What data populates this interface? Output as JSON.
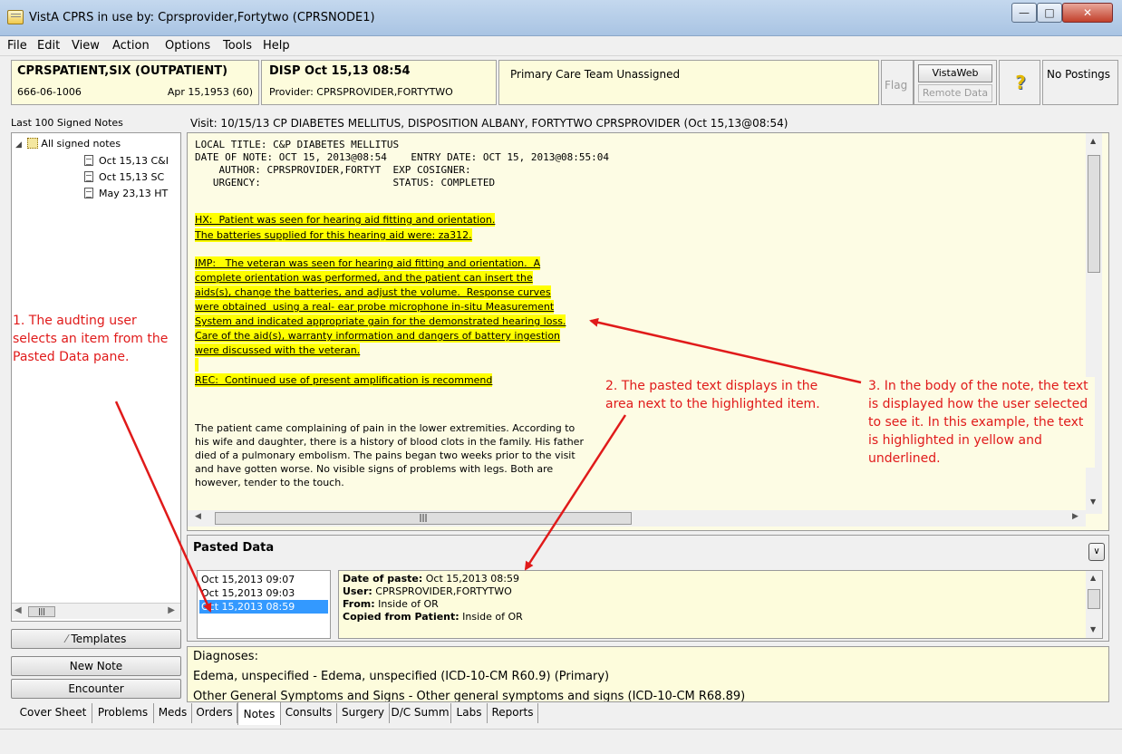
{
  "window": {
    "title": "VistA CPRS in use by: Cprsprovider,Fortytwo (CPRSNODE1)"
  },
  "menu": [
    "File",
    "Edit",
    "View",
    "Action",
    "Options",
    "Tools",
    "Help"
  ],
  "patient": {
    "name": "CPRSPATIENT,SIX (OUTPATIENT)",
    "ssn": "666-06-1006",
    "dob": "Apr 15,1953 (60)"
  },
  "visit_header": {
    "disp": "DISP Oct 15,13 08:54",
    "provider": "Provider:  CPRSPROVIDER,FORTYTWO"
  },
  "team": "Primary Care Team Unassigned",
  "flag": "Flag",
  "vistaweb": "VistaWeb",
  "remote_data": "Remote Data",
  "help_icon": "question-mark-icon",
  "postings": "No Postings",
  "notes_list": {
    "title": "Last 100 Signed Notes",
    "root": "All signed notes",
    "items": [
      "Oct 15,13 C&I",
      "Oct 15,13 SC",
      "May 23,13 HT"
    ]
  },
  "side_buttons": {
    "templates": "Templates",
    "new_note": "New Note",
    "encounter": "Encounter"
  },
  "visit_line": "Visit: 10/15/13  CP DIABETES MELLITUS, DISPOSITION ALBANY, FORTYTWO CPRSPROVIDER  (Oct 15,13@08:54)",
  "note": {
    "header": "LOCAL TITLE: C&P DIABETES MELLITUS\nDATE OF NOTE: OCT 15, 2013@08:54    ENTRY DATE: OCT 15, 2013@08:55:04\n    AUTHOR: CPRSPROVIDER,FORTYT  EXP COSIGNER:\n   URGENCY:                      STATUS: COMPLETED",
    "highlighted": [
      "HX:  Patient was seen for hearing aid fitting and orientation.",
      "The batteries supplied for this hearing aid were: za312.",
      "IMP:   The veteran was seen for hearing aid fitting and orientation.  A",
      "complete orientation was performed, and the patient can insert the",
      "aids(s), change the batteries, and adjust the volume.  Response curves",
      "were obtained  using a real- ear probe microphone in-situ Measurement",
      "System and indicated appropriate gain for the demonstrated hearing loss.",
      "Care of the aid(s), warranty information and dangers of battery ingestion",
      "were discussed with the veteran.",
      "REC:  Continued use of present amplification is recommend"
    ],
    "body": "The patient came complaining of pain in the lower extremities. According to his wife and daughter, there is a history of blood clots in the family. His father died of a pulmonary embolism. The pains began two weeks prior to the visit and have gotten worse. No visible signs of problems with legs. Both are however, tender to the touch."
  },
  "pasted": {
    "title": "Pasted Data",
    "list": [
      "Oct 15,2013 09:07",
      "Oct 15,2013 09:03",
      "Oct 15,2013 08:59"
    ],
    "selected_index": 2,
    "detail": [
      {
        "label": "Date of paste:",
        "value": "Oct 15,2013 08:59"
      },
      {
        "label": "User:",
        "value": "CPRSPROVIDER,FORTYTWO"
      },
      {
        "label": "From:",
        "value": "Inside of OR"
      },
      {
        "label": "Copied from Patient:",
        "value": "Inside of OR"
      }
    ]
  },
  "diagnoses": {
    "title": "Diagnoses:",
    "line1": "Edema, unspecified - Edema, unspecified (ICD-10-CM R60.9) (Primary)",
    "line2": "Other General Symptoms and Signs - Other general symptoms and signs (ICD-10-CM R68.89)"
  },
  "tabs": [
    "Cover Sheet",
    "Problems",
    "Meds",
    "Orders",
    "Notes",
    "Consults",
    "Surgery",
    "D/C Summ",
    "Labs",
    "Reports"
  ],
  "active_tab": "Notes",
  "annotations": {
    "a1": "1. The audting user selects an item from the Pasted Data pane.",
    "a2": "2. The pasted text displays in the area next to the highlighted item.",
    "a3": "3. In the body of the note, the text is displayed how the user selected to see it. In this example, the text is highlighted in yellow and underlined."
  },
  "colors": {
    "annotation": "#e01a1a",
    "highlight": "#ffff00",
    "selection": "#3399ff",
    "note_bg": "#fdfce4"
  }
}
